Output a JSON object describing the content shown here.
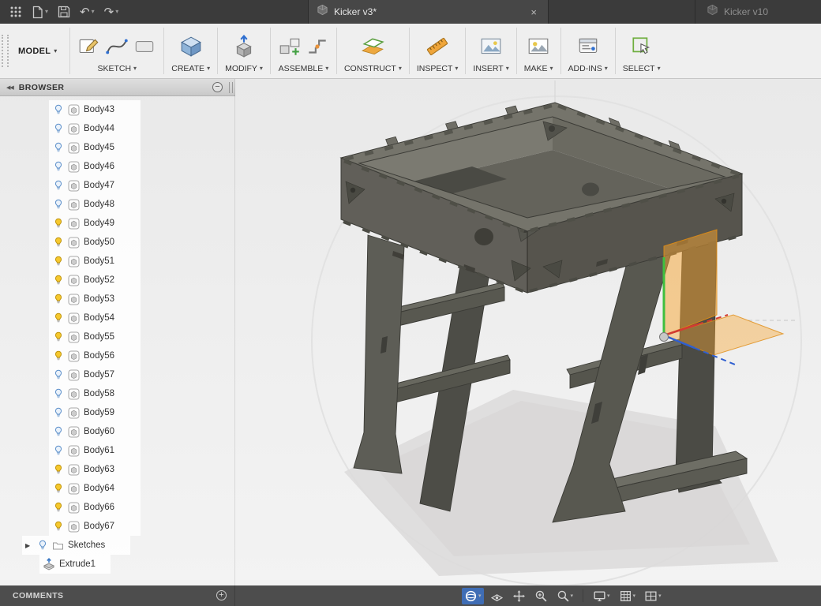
{
  "titlebar": {
    "active_tab": "Kicker v3*",
    "inactive_tab": "Kicker v10"
  },
  "toolbar": {
    "workspace_label": "MODEL",
    "groups": [
      {
        "label": "SKETCH"
      },
      {
        "label": "CREATE"
      },
      {
        "label": "MODIFY"
      },
      {
        "label": "ASSEMBLE"
      },
      {
        "label": "CONSTRUCT"
      },
      {
        "label": "INSPECT"
      },
      {
        "label": "INSERT"
      },
      {
        "label": "MAKE"
      },
      {
        "label": "ADD-INS"
      },
      {
        "label": "SELECT"
      }
    ]
  },
  "browser": {
    "title": "BROWSER",
    "bodies": [
      {
        "label": "Body43",
        "visible": false
      },
      {
        "label": "Body44",
        "visible": false
      },
      {
        "label": "Body45",
        "visible": false
      },
      {
        "label": "Body46",
        "visible": false
      },
      {
        "label": "Body47",
        "visible": false
      },
      {
        "label": "Body48",
        "visible": false
      },
      {
        "label": "Body49",
        "visible": true
      },
      {
        "label": "Body50",
        "visible": true
      },
      {
        "label": "Body51",
        "visible": true
      },
      {
        "label": "Body52",
        "visible": true
      },
      {
        "label": "Body53",
        "visible": true
      },
      {
        "label": "Body54",
        "visible": true
      },
      {
        "label": "Body55",
        "visible": true
      },
      {
        "label": "Body56",
        "visible": true
      },
      {
        "label": "Body57",
        "visible": false
      },
      {
        "label": "Body58",
        "visible": false
      },
      {
        "label": "Body59",
        "visible": false
      },
      {
        "label": "Body60",
        "visible": false
      },
      {
        "label": "Body61",
        "visible": false
      },
      {
        "label": "Body63",
        "visible": true
      },
      {
        "label": "Body64",
        "visible": true
      },
      {
        "label": "Body66",
        "visible": true
      },
      {
        "label": "Body67",
        "visible": true
      }
    ],
    "sketches_label": "Sketches",
    "feature_label": "Extrude1"
  },
  "statusbar": {
    "comments_label": "COMMENTS"
  },
  "viewport": {
    "model_color": "#5e5e57",
    "construction_plane_color": "#f7a631",
    "axis_colors": {
      "vertical": "#3fbf3f",
      "right": "#d23b31",
      "front": "#2f5fd0"
    }
  }
}
